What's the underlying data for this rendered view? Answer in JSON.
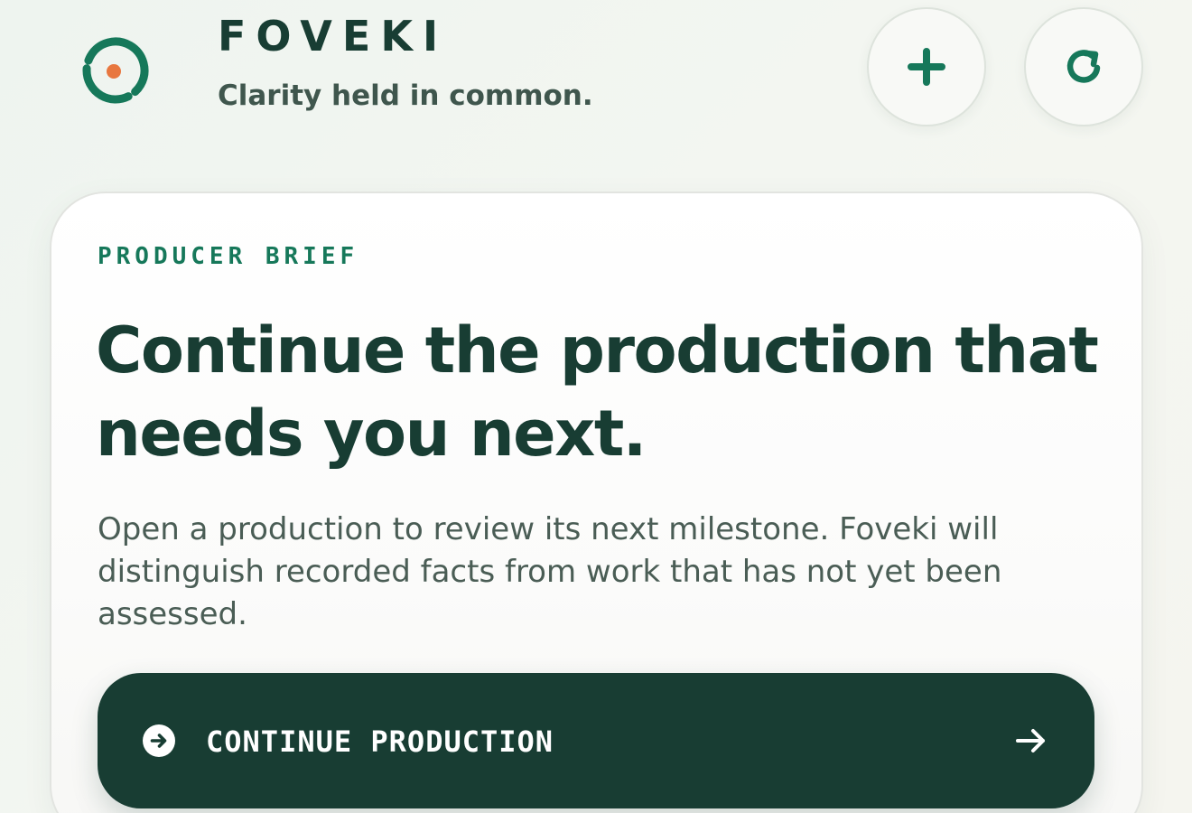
{
  "header": {
    "brand_name": "FOVEKI",
    "tagline": "Clarity held in common.",
    "logo_icon": "foveki-logo-icon",
    "actions": [
      {
        "name": "add-button",
        "icon": "plus-icon"
      },
      {
        "name": "refresh-button",
        "icon": "refresh-icon"
      }
    ]
  },
  "brief": {
    "eyebrow": "PRODUCER BRIEF",
    "headline": "Continue the production that needs you next.",
    "body": "Open a production to review its next milestone. Foveki will distinguish recorded facts from work that has not yet been assessed.",
    "cta": {
      "label": "CONTINUE PRODUCTION",
      "lead_icon": "arrow-circle-right-icon",
      "trail_icon": "arrow-right-icon"
    }
  },
  "colors": {
    "brand_dark": "#183d33",
    "accent_green": "#16785a",
    "accent_orange": "#e8773f",
    "muted_text": "#4a5d55"
  }
}
